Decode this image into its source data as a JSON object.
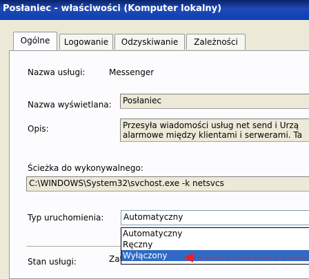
{
  "window": {
    "title": "Posłaniec - właściwości (Komputer lokalny)"
  },
  "tabs": [
    {
      "label": "Ogólne",
      "active": true
    },
    {
      "label": "Logowanie",
      "active": false
    },
    {
      "label": "Odzyskiwanie",
      "active": false
    },
    {
      "label": "Zależności",
      "active": false
    }
  ],
  "general": {
    "service_name_label": "Nazwa usługi:",
    "service_name_value": "Messenger",
    "display_name_label": "Nazwa wyświetlana:",
    "display_name_value": "Posłaniec",
    "description_label": "Opis:",
    "description_value": "Przesyła wiadomości usług net send i Urzą alarmowe między klientami i serwerami. Ta",
    "path_label": "Ścieżka do wykonywalnego:",
    "path_value": "C:\\WINDOWS\\System32\\svchost.exe -k netsvcs",
    "startup_label": "Typ uruchomienia:",
    "startup_value": "Automatyczny",
    "startup_options": [
      "Automatyczny",
      "Ręczny",
      "Wyłączony"
    ],
    "startup_highlighted": "Wyłączony",
    "status_label": "Stan usługi:",
    "status_value": "Zatrzymano"
  },
  "colors": {
    "annotation_arrow": "#e8202a",
    "selection": "#316ac5"
  }
}
